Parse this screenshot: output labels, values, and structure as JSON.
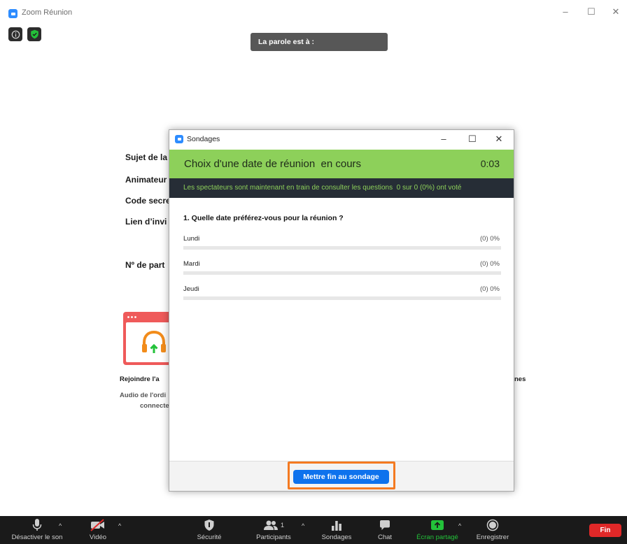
{
  "window": {
    "title": "Zoom Réunion",
    "minimize": "–",
    "maximize": "☐",
    "close": "✕"
  },
  "speaker_banner": "La parole est à :",
  "meeting_info": {
    "labels": [
      "Sujet de la",
      "Animateur",
      "Code secre",
      "Lien d’invi",
      "Nº de part"
    ],
    "join_audio_title": "Rejoindre l'a",
    "join_audio_desc_1": "Audio de l'ordi",
    "join_audio_desc_2": "connecte",
    "right_fragment": "nes"
  },
  "poll_dialog": {
    "title": "Sondages",
    "minimize": "–",
    "maximize": "☐",
    "close": "✕",
    "poll_title": "Choix d'une date de réunion  en cours",
    "timer": "0:03",
    "status": "Les spectateurs sont maintenant en train de consulter les questions  0 sur 0 (0%) ont voté",
    "question": "1. Quelle date préférez-vous pour la réunion ?",
    "options": [
      {
        "label": "Lundi",
        "result": "(0) 0%",
        "percent": 0
      },
      {
        "label": "Mardi",
        "result": "(0) 0%",
        "percent": 0
      },
      {
        "label": "Jeudi",
        "result": "(0) 0%",
        "percent": 0
      }
    ],
    "end_button": "Mettre fin au sondage"
  },
  "toolbar": {
    "mute": "Désactiver le son",
    "video": "Vidéo",
    "security": "Sécurité",
    "participants": "Participants",
    "participants_count": "1",
    "polls": "Sondages",
    "chat": "Chat",
    "share": "Écran partagé",
    "record": "Enregistrer",
    "end": "Fin"
  },
  "colors": {
    "poll_header": "#8dd05a",
    "status_bar": "#262d36",
    "primary_button": "#0e72ed",
    "highlight": "#f47a21",
    "share_active": "#23c23a",
    "end_button": "#e02828"
  }
}
